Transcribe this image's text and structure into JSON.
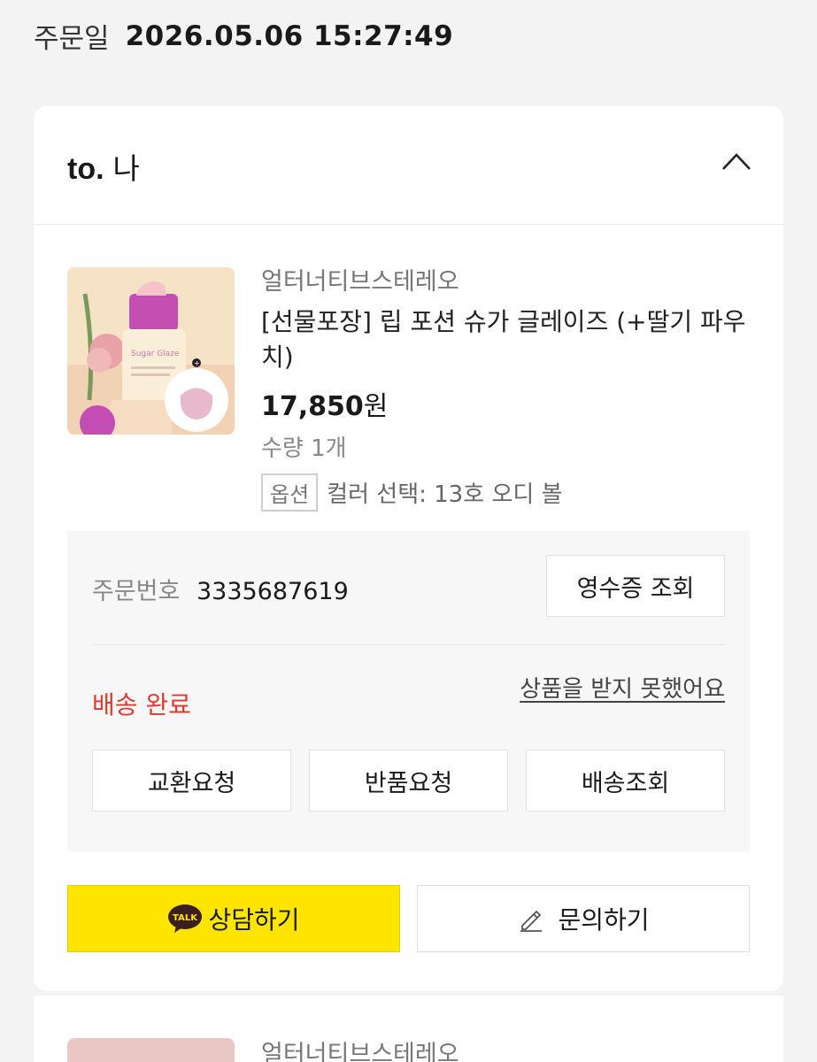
{
  "order": {
    "date_label": "주문일",
    "date_value": "2026.05.06 15:27:49"
  },
  "recipient": {
    "prefix": "to.",
    "name": "나"
  },
  "item": {
    "brand": "얼터너티브스테레오",
    "name": "[선물포장] 립 포션 슈가 글레이즈 (+딸기 파우치)",
    "price": "17,850",
    "currency": "원",
    "quantity": "수량 1개",
    "option_tag": "옵션",
    "option_value": "컬러 선택: 13호 오디 볼"
  },
  "panel": {
    "order_number_label": "주문번호",
    "order_number": "3335687619",
    "receipt_button": "영수증 조회",
    "status": "배송 완료",
    "not_received_link": "상품을 받지 못했어요",
    "actions": [
      "교환요청",
      "반품요청",
      "배송조회"
    ]
  },
  "buttons": {
    "chat_badge": "TALK",
    "chat": "상담하기",
    "inquiry": "문의하기"
  },
  "next_item": {
    "brand": "얼터너티브스테레오"
  },
  "colors": {
    "status": "#dd3b2d",
    "kakao_yellow": "#fee500",
    "background": "#f3f3f3"
  }
}
